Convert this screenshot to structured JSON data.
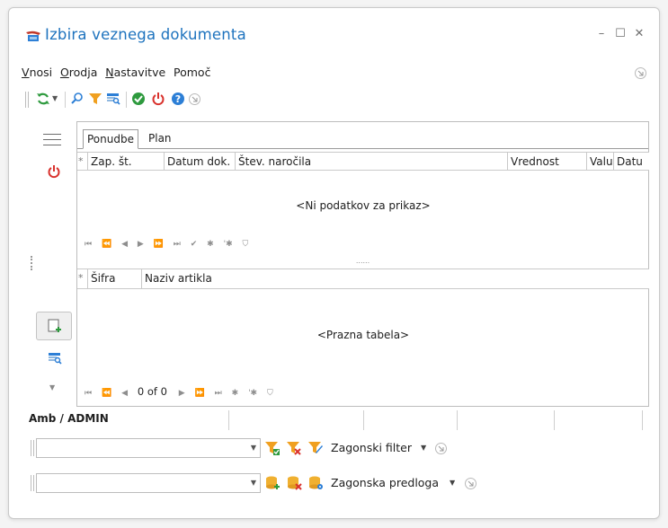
{
  "window": {
    "title": "Izbira veznega dokumenta",
    "controls": [
      "minimize",
      "maximize",
      "close"
    ]
  },
  "menu": {
    "items": [
      {
        "accel": "V",
        "rest": "nosi"
      },
      {
        "accel": "O",
        "rest": "rodja"
      },
      {
        "accel": "N",
        "rest": "astavitve"
      },
      {
        "accel": "",
        "rest": "Pomoč"
      }
    ]
  },
  "toolbar": {
    "icons": [
      "refresh-icon",
      "dropdown-icon",
      "search-icon",
      "filter-icon",
      "grid-search-icon",
      "confirm-icon",
      "power-icon",
      "help-icon",
      "more-icon"
    ]
  },
  "tabs": [
    {
      "label": "Ponudbe",
      "active": true
    },
    {
      "label": "Plan",
      "active": false
    }
  ],
  "top_grid": {
    "star": "*",
    "columns": [
      "Zap. št.",
      "Datum dok.",
      "Štev. naročila",
      "Vrednost",
      "Valu",
      "Datu"
    ],
    "empty_text": "<Ni podatkov za prikaz>",
    "nav": [
      "⏮",
      "⏪",
      "◀",
      "▶",
      "⏩",
      "⏭",
      "✔",
      "✱",
      "'✱",
      "⛉"
    ]
  },
  "splitter": "......",
  "bottom_grid": {
    "star": "*",
    "columns": [
      "Šifra",
      "Naziv artikla"
    ],
    "empty_text": "<Prazna tabela>",
    "count": "0 of 0"
  },
  "status": {
    "user": "Amb / ADMIN"
  },
  "filters": {
    "filter_label": "Zagonski filter",
    "template_label": "Zagonska predloga",
    "filter_value": "",
    "template_value": ""
  },
  "colors": {
    "title": "#1e73be",
    "accent_green": "#2e9a3e",
    "power_red": "#d9322d",
    "help_blue": "#2d7fd6",
    "filter_orange": "#f0a020"
  }
}
